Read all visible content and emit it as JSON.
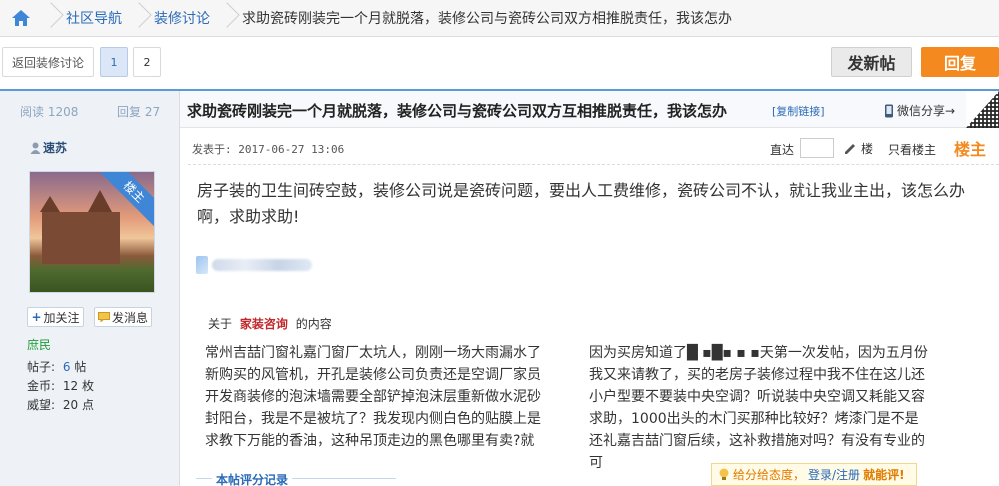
{
  "breadcrumb": {
    "home_icon": "home-icon",
    "items": [
      "社区导航",
      "装修讨论"
    ],
    "current": "求助瓷砖刚装完一个月就脱落，装修公司与瓷砖公司双方相推脱责任，我该怎办"
  },
  "toolbar": {
    "back_label": "返回装修讨论",
    "pages": [
      "1",
      "2"
    ],
    "new_post_label": "发新帖",
    "reply_label": "回复"
  },
  "post_header": {
    "read_label": "阅读 1208",
    "reply_count_label": "回复 27",
    "title": "求助瓷砖刚装完一个月就脱落，装修公司与瓷砖公司双方互相推脱责任，我该怎办",
    "copy_link": "[复制链接]",
    "share_label": "微信分享→"
  },
  "author": {
    "name": "速苏",
    "badge": "楼主",
    "follow_label": "加关注",
    "message_label": "发消息",
    "rank": "庶民",
    "posts_label": "帖子:",
    "posts_value": "6",
    "posts_unit": "帖",
    "coins_label": "金币:",
    "coins_value": "12",
    "coins_unit": "枚",
    "prestige_label": "威望:",
    "prestige_value": "20",
    "prestige_unit": "点"
  },
  "post_meta": {
    "posted_at": "发表于: 2017-06-27 13:06",
    "jump_label": "直达",
    "floor_label": "楼",
    "only_op_label": "只看楼主",
    "op_tag": "楼主"
  },
  "post": {
    "body": "房子装的卫生间砖空鼓，装修公司说是瓷砖问题，要出人工费维修，瓷砖公司不认，就让我业主出，该怎么办啊，求助求助!",
    "related_prefix": "关于",
    "related_keyword": "家装咨询",
    "related_suffix": "的内容",
    "col_left": "常州吉喆门窗礼嘉门窗厂太坑人，刚刚一场大雨漏水了新购买的风管机，开孔是装修公司负责还是空调厂家员开发商装修的泡沫墙需要全部铲掉泡沫层重新做水泥砂封阳台，我是不是被坑了？我发现内侧白色的贴膜上是求教下万能的香油，这种吊顶走边的黑色哪里有卖?就",
    "col_right": "因为买房知道了█ ▪█▪ ▪ ▪天第一次发帖，因为五月份我又来请教了，买的老房子装修过程中我不住在这儿还小户型要不要装中央空调？听说装中央空调又耗能又容求助，1000出头的木门买那种比较好？烤漆门是不是还礼嘉吉喆门窗后续，这补救措施对吗？有没有专业的可"
  },
  "rating": {
    "section_title": "本帖评分记录",
    "tip_part1": "给分给态度，",
    "tip_link": "登录/注册",
    "tip_part2": "就能评!"
  }
}
